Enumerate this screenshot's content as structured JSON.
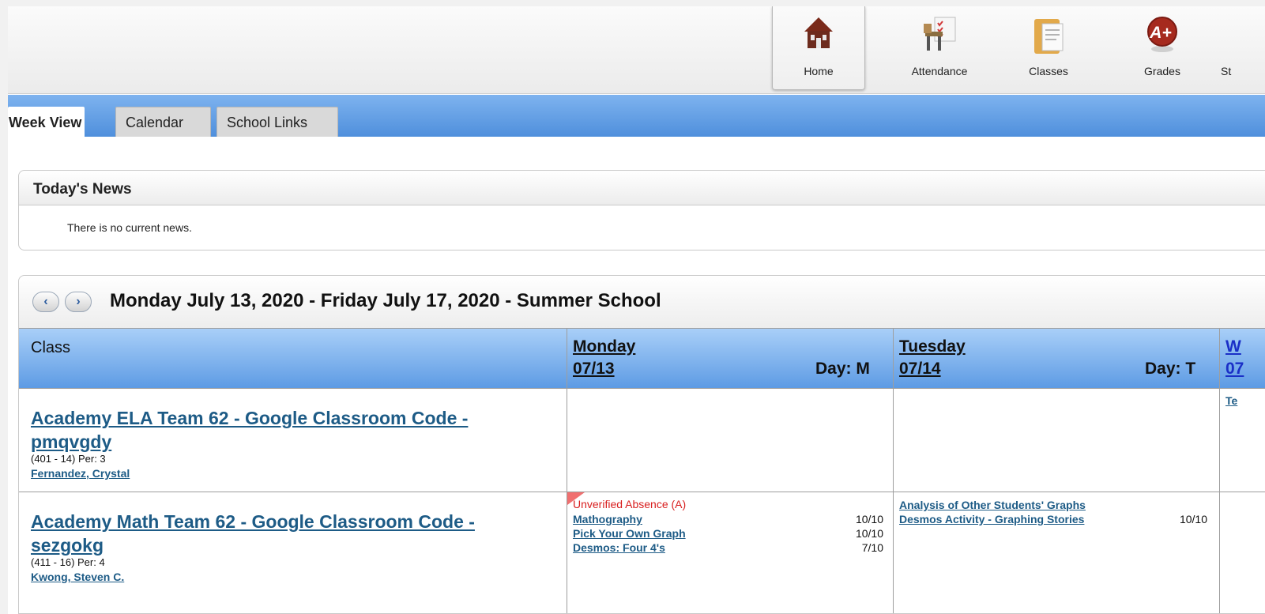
{
  "nav": {
    "items": [
      {
        "label": "Home",
        "icon": "home-icon",
        "active": true
      },
      {
        "label": "Attendance",
        "icon": "attendance-icon"
      },
      {
        "label": "Classes",
        "icon": "classes-icon"
      },
      {
        "label": "Grades",
        "icon": "grades-icon"
      },
      {
        "label": "St",
        "icon": "student-icon"
      }
    ],
    "grades_badge": "A+"
  },
  "tabs": [
    {
      "label": "Week View",
      "active": true
    },
    {
      "label": "Calendar"
    },
    {
      "label": "School Links"
    }
  ],
  "news": {
    "title": "Today's News",
    "message": "There is no current news."
  },
  "week": {
    "prev_symbol": "‹",
    "next_symbol": "›",
    "range_title": "Monday July 13, 2020 - Friday July 17, 2020 - Summer School",
    "class_header": "Class",
    "days": [
      {
        "name": "Monday",
        "date": "07/13",
        "day_letter": "Day: M"
      },
      {
        "name": "Tuesday",
        "date": "07/14",
        "day_letter": "Day: T"
      },
      {
        "name": "W",
        "date": "07"
      }
    ],
    "rows": [
      {
        "class_line1": "Academy ELA Team 62 - Google Classroom Code -",
        "class_line2": "pmqvgdy",
        "meta": "(401 - 14) Per: 3",
        "teacher": "Fernandez, Crystal",
        "wednesday_partial": "Te"
      },
      {
        "class_line1": "Academy Math Team 62 - Google Classroom Code -",
        "class_line2": "sezgokg",
        "meta": "(411 - 16) Per: 4",
        "teacher": "Kwong, Steven C.",
        "monday": {
          "absence": "Unverified Absence (A)",
          "assignments": [
            {
              "title": "Mathography",
              "score": "10/10"
            },
            {
              "title": "Pick Your Own Graph",
              "score": "10/10"
            },
            {
              "title": "Desmos: Four 4's",
              "score": "7/10"
            }
          ]
        },
        "tuesday": {
          "assignments": [
            {
              "title": "Analysis of Other Students' Graphs",
              "score": ""
            },
            {
              "title": "Desmos Activity - Graphing Stories",
              "score": "10/10"
            }
          ]
        }
      }
    ]
  },
  "colors": {
    "tab_bar": "#5f9be3",
    "link": "#1d5b86",
    "absence": "#d81e1e",
    "grid_header": "#7fb4ef"
  }
}
